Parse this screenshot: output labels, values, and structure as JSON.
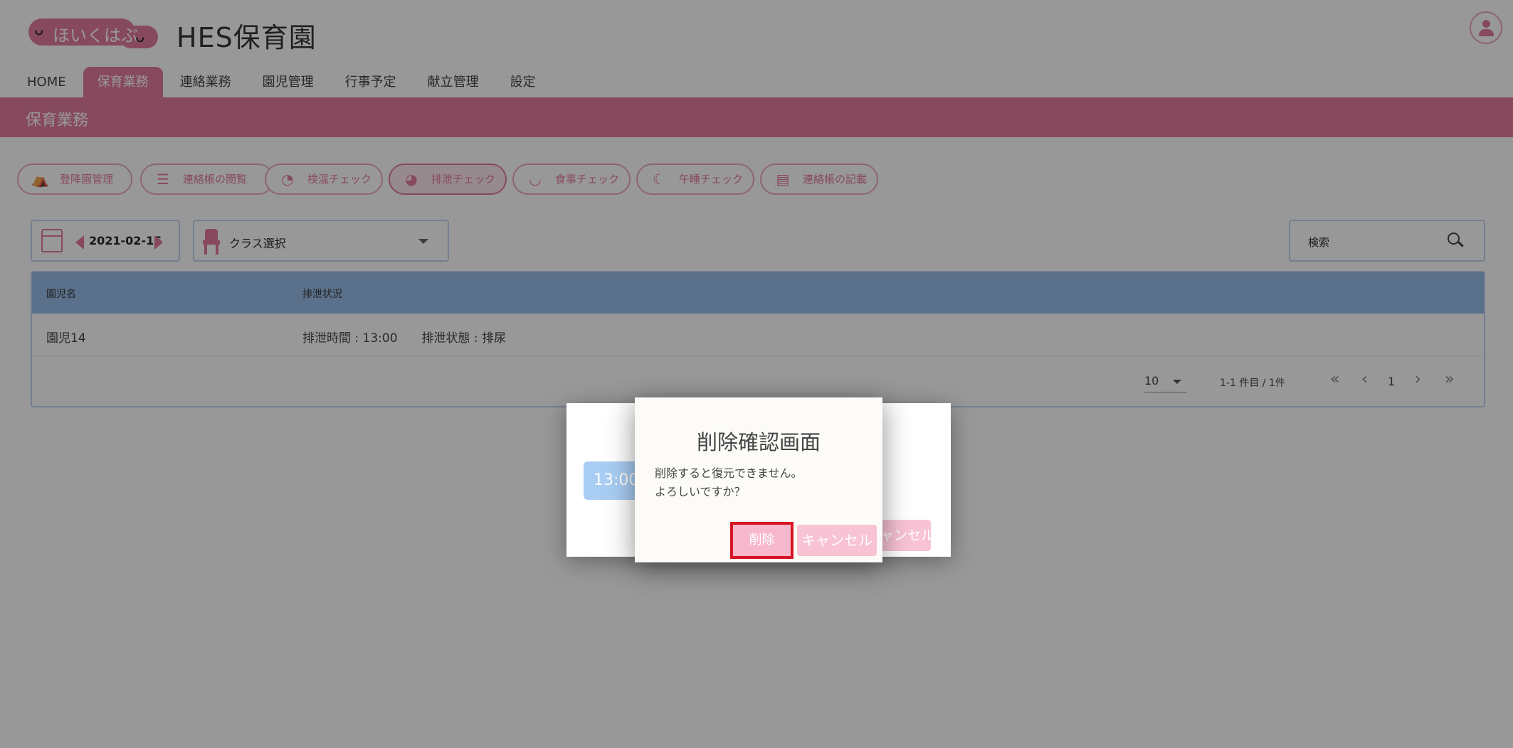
{
  "header": {
    "logo_text": "ほいくはぶ",
    "logo_smile": "ᴗ",
    "app_title": "HES保育園"
  },
  "nav": {
    "items": [
      "HOME",
      "保育業務",
      "連絡業務",
      "園児管理",
      "行事予定",
      "献立管理",
      "設定"
    ],
    "active": "保育業務"
  },
  "band": {
    "title": "保育業務"
  },
  "subtabs": [
    {
      "label": "登降園管理",
      "icon": "tent-icon"
    },
    {
      "label": "連絡帳の閲覧",
      "icon": "list-icon"
    },
    {
      "label": "検温チェック",
      "icon": "thermometer-icon"
    },
    {
      "label": "排泄チェック",
      "icon": "duck-icon",
      "active": true
    },
    {
      "label": "食事チェック",
      "icon": "bowl-icon"
    },
    {
      "label": "午睡チェック",
      "icon": "sleep-icon"
    },
    {
      "label": "連絡帳の記載",
      "icon": "notebook-icon"
    }
  ],
  "filters": {
    "date": "2021-02-15",
    "class_placeholder": "クラス選択",
    "search_placeholder": "検索"
  },
  "table": {
    "headers": [
      "園児名",
      "排泄状況"
    ],
    "rows": [
      {
        "name": "園児14",
        "status": "排泄時間 : 13:00　　排泄状態 : 排尿"
      }
    ]
  },
  "pagination": {
    "page_size": "10",
    "range": "1-1 件目 / 1件",
    "first": "«",
    "prev": "‹",
    "page": "1",
    "next": "›",
    "last": "»"
  },
  "dialog_back": {
    "chip_text": "13:00",
    "cancel_label": "キャンセル"
  },
  "dialog": {
    "title": "削除確認画面",
    "message_line1": "削除すると復元できません。",
    "message_line2": "よろしいですか？",
    "delete_label": "削除",
    "cancel_label": "キャンセル"
  },
  "colors": {
    "brand_pink": "#e06e94",
    "table_header_blue": "#8fb6e6",
    "highlight_red": "#d61424"
  }
}
